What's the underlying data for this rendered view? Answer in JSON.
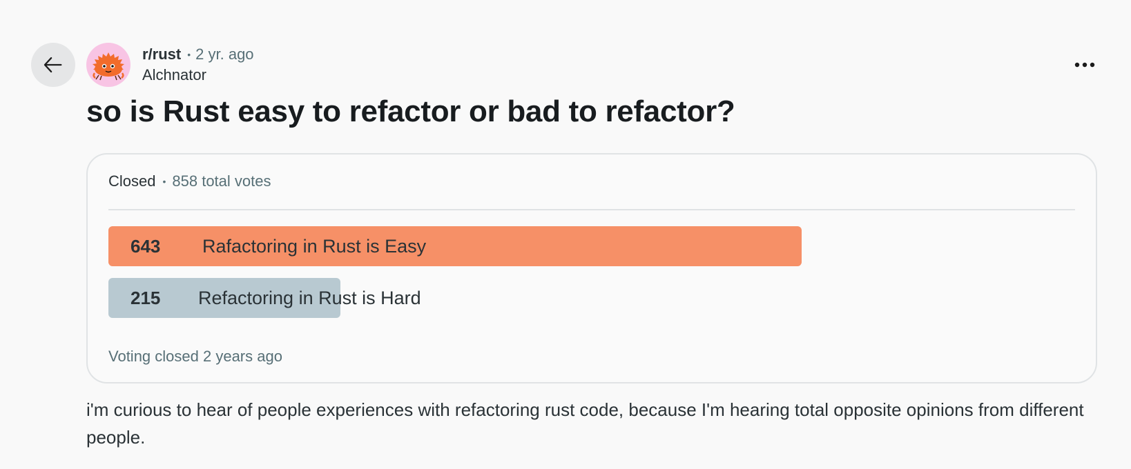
{
  "header": {
    "subreddit": "r/rust",
    "separator": "•",
    "time_ago": "2 yr. ago",
    "author": "Alchnator",
    "back_icon": "arrow-left-icon",
    "overflow_icon": "ellipsis-icon"
  },
  "post": {
    "title": "so is Rust easy to refactor or bad to refactor?",
    "body": "i'm curious to hear of people experiences with refactoring rust code, because I'm hearing total opposite opinions from different people."
  },
  "poll": {
    "status": "Closed",
    "separator": "•",
    "total_votes": "858 total votes",
    "options": [
      {
        "count": "643",
        "label": "Rafactoring in Rust is Easy",
        "share": 0.717,
        "color": "#f69067"
      },
      {
        "count": "215",
        "label": "Refactoring in Rust is Hard",
        "share": 0.24,
        "color": "#b8c9d1"
      }
    ],
    "footer": "Voting closed 2 years ago"
  },
  "colors": {
    "background": "#f9f9f9",
    "avatar_bg": "#f8c4e4",
    "mascot": "#f26c2b"
  }
}
